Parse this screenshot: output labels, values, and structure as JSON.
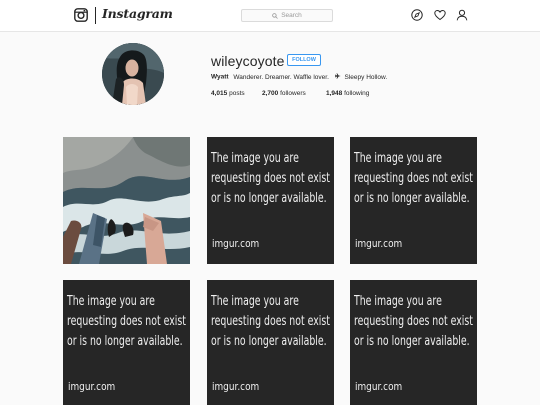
{
  "nav": {
    "brand": "Instagram",
    "search_placeholder": "Search",
    "icons": [
      "explore-compass-icon",
      "heart-icon",
      "profile-icon"
    ]
  },
  "profile": {
    "username": "wileycoyote",
    "follow_label": "FOLLOW",
    "name": "Wyatt",
    "bio": "Wanderer. Dreamer. Waffle lover.",
    "location_icon": "airplane-icon",
    "location": "Sleepy Hollow.",
    "stats": {
      "posts_count": "4,015",
      "posts_label": "posts",
      "followers_count": "2,700",
      "followers_label": "followers",
      "following_count": "1,948",
      "following_label": "following"
    }
  },
  "grid": {
    "photo_alt": "legs dangling over rocks and water",
    "placeholder_text": "The image you are\nrequesting does not exist\nor is no longer available.",
    "placeholder_site": "imgur.com"
  },
  "colors": {
    "accent": "#3897f0",
    "background": "#fafafa",
    "text": "#262626",
    "placeholder_bg": "#262626"
  }
}
